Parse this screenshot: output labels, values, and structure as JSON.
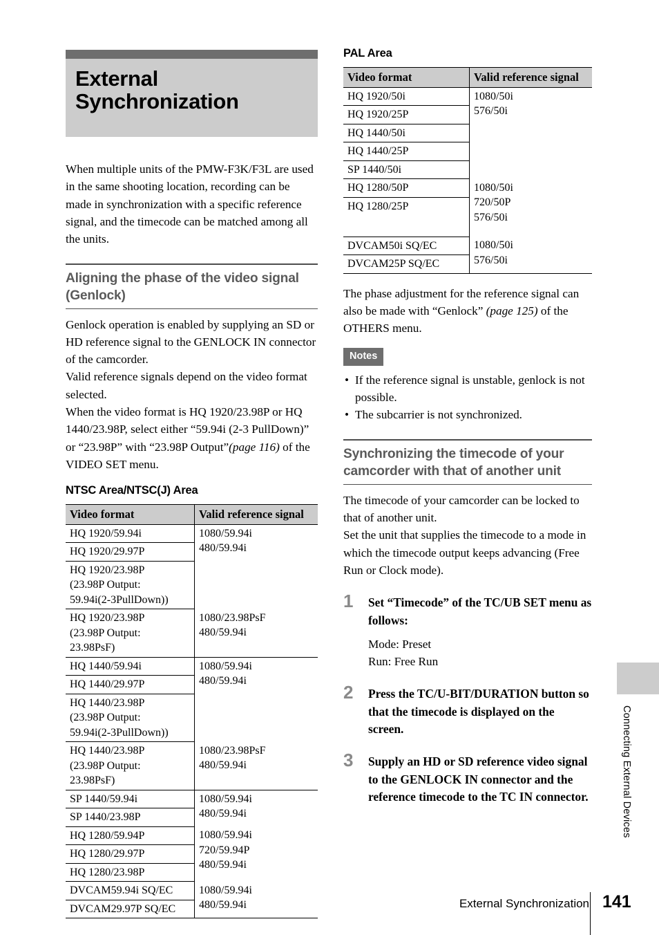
{
  "chapter": {
    "title": "External Synchronization"
  },
  "intro": "When multiple units of the PMW-F3K/F3L are used in the same shooting location, recording can be made in synchronization with a specific reference signal, and the timecode can be matched among all the units.",
  "section_genlock": {
    "heading": "Aligning the phase of the video signal (Genlock)",
    "paragraphs": [
      "Genlock operation is enabled by supplying an SD or HD reference signal to the GENLOCK IN connector of the camcorder.",
      "Valid reference signals depend on the video format selected.",
      "When the video format is HQ 1920/23.98P or HQ 1440/23.98P, select either “59.94i (2-3 PullDown)” or “23.98P” with “23.98P Output”",
      " of the VIDEO SET menu."
    ],
    "page_ref": "(page 116)"
  },
  "ntsc": {
    "sub_heading": "NTSC Area/NTSC(J) Area",
    "columns": [
      "Video format",
      "Valid reference signal"
    ],
    "groups": [
      {
        "formats": [
          "HQ 1920/59.94i",
          "HQ 1920/29.97P",
          "HQ 1920/23.98P\n(23.98P Output:\n59.94i(2-3PullDown))"
        ],
        "signal": "1080/59.94i\n480/59.94i"
      },
      {
        "formats": [
          "HQ 1920/23.98P\n(23.98P Output:\n23.98PsF)"
        ],
        "signal": "1080/23.98PsF\n480/59.94i"
      },
      {
        "formats": [
          "HQ 1440/59.94i",
          "HQ 1440/29.97P",
          "HQ 1440/23.98P\n(23.98P Output:\n59.94i(2-3PullDown))"
        ],
        "signal": "1080/59.94i\n480/59.94i"
      },
      {
        "formats": [
          "HQ 1440/23.98P\n(23.98P Output:\n23.98PsF)"
        ],
        "signal": "1080/23.98PsF\n480/59.94i"
      },
      {
        "formats": [
          "SP 1440/59.94i",
          "SP 1440/23.98P"
        ],
        "signal": "1080/59.94i\n480/59.94i"
      },
      {
        "formats": [
          "HQ 1280/59.94P",
          "HQ 1280/29.97P",
          "HQ 1280/23.98P"
        ],
        "signal": "1080/59.94i\n720/59.94P\n480/59.94i"
      },
      {
        "formats": [
          "DVCAM59.94i SQ/EC",
          "DVCAM29.97P SQ/EC"
        ],
        "signal": "1080/59.94i\n480/59.94i"
      }
    ]
  },
  "pal": {
    "sub_heading": "PAL Area",
    "columns": [
      "Video format",
      "Valid reference signal"
    ],
    "groups": [
      {
        "formats": [
          "HQ 1920/50i",
          "HQ 1920/25P",
          "HQ 1440/50i"
        ],
        "signal": "1080/50i\n576/50i"
      },
      {
        "formats": [
          "HQ 1440/25P",
          "SP 1440/50i"
        ],
        "signal": ""
      },
      {
        "formats": [
          "HQ 1280/50P",
          "HQ 1280/25P"
        ],
        "signal": "1080/50i\n720/50P\n576/50i"
      },
      {
        "formats": [
          "DVCAM50i SQ/EC",
          "DVCAM25P SQ/EC"
        ],
        "signal": "1080/50i\n576/50i"
      }
    ]
  },
  "phase_note": {
    "text_a": "The phase adjustment for the reference signal can also be made with “Genlock” ",
    "page_ref": "(page 125)",
    "text_b": " of the OTHERS menu."
  },
  "notes": {
    "badge": "Notes",
    "items": [
      "If the reference signal is unstable, genlock is not possible.",
      "The subcarrier is not synchronized."
    ]
  },
  "section_timecode": {
    "heading": "Synchronizing the timecode of your camcorder with that of another unit",
    "paragraphs": [
      "The timecode of your camcorder can be locked to that of another unit.",
      "Set the unit that supplies the timecode to a mode in which the timecode output keeps advancing (Free Run or Clock mode)."
    ],
    "steps": [
      {
        "num": "1",
        "title": "Set “Timecode” of the TC/UB SET menu as follows:",
        "body": "Mode: Preset\nRun: Free Run"
      },
      {
        "num": "2",
        "title": "Press the TC/U-BIT/DURATION button so that the timecode is displayed on the screen.",
        "body": ""
      },
      {
        "num": "3",
        "title": "Supply an HD or SD reference video signal to the GENLOCK IN connector and the reference timecode to the TC IN connector.",
        "body": ""
      }
    ]
  },
  "side_tab": {
    "label": "Connecting External Devices"
  },
  "footer": {
    "title": "External Synchronization",
    "page": "141"
  },
  "colors": {
    "title_bar": "#6e6e6e",
    "title_bg": "#cccccc",
    "heading_gray": "#5a5a5a",
    "step_num_gray": "#8a8a8a",
    "badge_bg": "#6e6e6e",
    "table_head_bg": "#cccccc"
  }
}
